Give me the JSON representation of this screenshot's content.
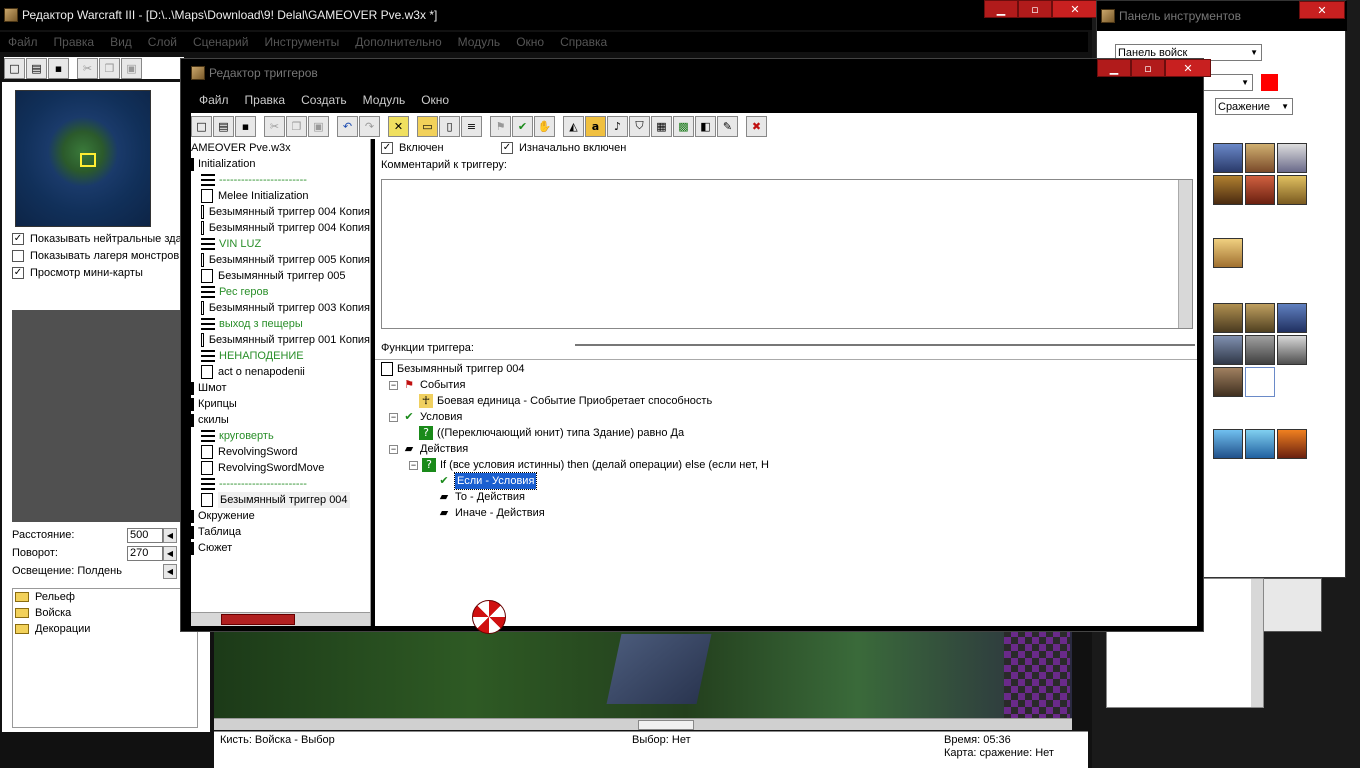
{
  "main_window": {
    "title": "Редактор Warcraft III - [D:\\..\\Maps\\Download\\9! Delal\\GAMEOVER Pve.w3x *]",
    "menu": [
      "Файл",
      "Правка",
      "Вид",
      "Слой",
      "Сценарий",
      "Инструменты",
      "Дополнительно",
      "Модуль",
      "Окно",
      "Справка"
    ],
    "minimap_options": [
      {
        "label": "Показывать нейтральные здания",
        "checked": true
      },
      {
        "label": "Показывать лагеря монстров",
        "checked": false
      },
      {
        "label": "Просмотр мини-карты",
        "checked": true
      }
    ],
    "camera": {
      "distance_label": "Расстояние:",
      "distance_value": "500",
      "rotation_label": "Поворот:",
      "rotation_value": "270",
      "lighting": "Освещение: Полдень"
    },
    "palette_folders": [
      "Рельеф",
      "Войска",
      "Декорации"
    ],
    "status": {
      "brush": "Кисть: Войска - Выбор",
      "selection": "Выбор: Нет",
      "time": "Время: 05:36",
      "map": "Карта: сражение: Нет"
    }
  },
  "tool_panel": {
    "title": "Панель инструментов",
    "palette_select": "Панель войск",
    "category_select": "Сражение",
    "player_color": "#ff0000"
  },
  "trigger_editor": {
    "title": "Редактор триггеров",
    "menu": [
      "Файл",
      "Правка",
      "Создать",
      "Модуль",
      "Окно"
    ],
    "tree": [
      {
        "text": "AMEOVER Pve.w3x",
        "kind": "root",
        "indent": 0
      },
      {
        "text": "Initialization",
        "kind": "folder",
        "indent": 0
      },
      {
        "text": "------------------------",
        "kind": "comment",
        "indent": 1,
        "green": true
      },
      {
        "text": "Melee Initialization",
        "kind": "trigger",
        "indent": 1
      },
      {
        "text": "Безымянный триггер 004 Копия",
        "kind": "trigger",
        "indent": 1
      },
      {
        "text": "Безымянный триггер 004 Копия",
        "kind": "trigger",
        "indent": 1
      },
      {
        "text": "VIN LUZ",
        "kind": "comment",
        "indent": 1,
        "green": true
      },
      {
        "text": "Безымянный триггер 005 Копия",
        "kind": "trigger",
        "indent": 1
      },
      {
        "text": "Безымянный триггер 005",
        "kind": "trigger",
        "indent": 1
      },
      {
        "text": "Рес геров",
        "kind": "comment",
        "indent": 1,
        "green": true
      },
      {
        "text": "Безымянный триггер 003 Копия",
        "kind": "trigger",
        "indent": 1
      },
      {
        "text": "выход з пещеры",
        "kind": "comment",
        "indent": 1,
        "green": true
      },
      {
        "text": "Безымянный триггер 001 Копия",
        "kind": "trigger",
        "indent": 1
      },
      {
        "text": "НЕНАПОДЕНИЕ",
        "kind": "comment",
        "indent": 1,
        "green": true
      },
      {
        "text": "act o nenapodenii",
        "kind": "trigger",
        "indent": 1
      },
      {
        "text": "Шмот",
        "kind": "folder",
        "indent": 0
      },
      {
        "text": "Крипцы",
        "kind": "folder",
        "indent": 0
      },
      {
        "text": "скилы",
        "kind": "folder",
        "indent": 0
      },
      {
        "text": "круговерть",
        "kind": "comment",
        "indent": 1,
        "green": true
      },
      {
        "text": "RevolvingSword",
        "kind": "trigger",
        "indent": 1
      },
      {
        "text": "RevolvingSwordMove",
        "kind": "trigger",
        "indent": 1
      },
      {
        "text": "------------------------",
        "kind": "comment",
        "indent": 1,
        "green": true
      },
      {
        "text": "Безымянный триггер 004",
        "kind": "trigger",
        "indent": 1,
        "selected": true
      },
      {
        "text": "Окружение",
        "kind": "folder",
        "indent": 0
      },
      {
        "text": "Таблица",
        "kind": "folder",
        "indent": 0
      },
      {
        "text": "Сюжет",
        "kind": "folder",
        "indent": 0
      }
    ],
    "enabled_label": "Включен",
    "initially_on_label": "Изначально включен",
    "comment_label": "Комментарий к триггеру:",
    "functions_label": "Функции триггера:",
    "functions": [
      {
        "text": "Безымянный триггер 004",
        "icon": "doc",
        "x": 0,
        "expander": false
      },
      {
        "text": "События",
        "icon": "flag",
        "x": 8,
        "expander": true
      },
      {
        "text": "Боевая единица - Событие Приобретает способность",
        "icon": "unit-event",
        "x": 38,
        "expander": false
      },
      {
        "text": "Условия",
        "icon": "condition",
        "x": 8,
        "expander": true
      },
      {
        "text": "((Переключающий юнит) типа Здание) равно Да",
        "icon": "question",
        "x": 38,
        "expander": false
      },
      {
        "text": "Действия",
        "icon": "action",
        "x": 8,
        "expander": true
      },
      {
        "text": "If (все условия истинны) then (делай операции) else (если нет, Н",
        "icon": "question",
        "x": 28,
        "expander": true
      },
      {
        "text": "Если - Условия",
        "icon": "condition",
        "x": 56,
        "expander": false,
        "selected": true
      },
      {
        "text": "То - Действия",
        "icon": "action",
        "x": 56,
        "expander": false
      },
      {
        "text": "Иначе - Действия",
        "icon": "action",
        "x": 56,
        "expander": false
      }
    ]
  },
  "icons": {
    "new": "□",
    "open": "▤",
    "save": "▪",
    "cut": "✂",
    "copy": "❐",
    "paste": "▣",
    "undo": "↶",
    "redo": "↷",
    "x": "✕",
    "folder": "▭",
    "page": "▯",
    "lines": "≡",
    "flag": "⚑",
    "green": "✔",
    "gray": "✋",
    "terrain": "◭",
    "a": "a",
    "sound": "♪",
    "shield": "⛉",
    "list": "▦",
    "map": "▩",
    "box": "◧",
    "script": "✎",
    "close": "✖"
  }
}
